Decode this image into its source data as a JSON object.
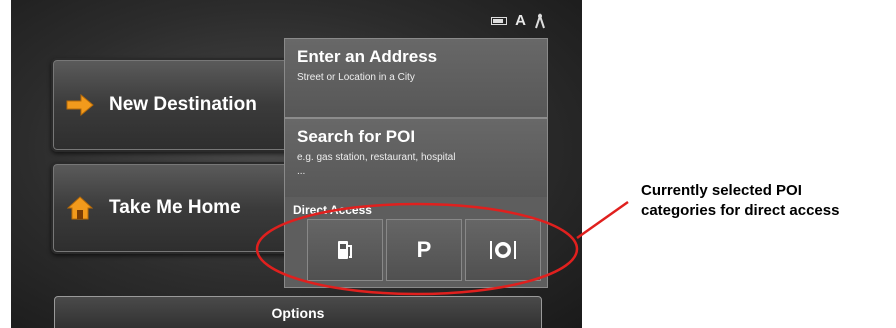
{
  "menu": {
    "new_destination": "New Destination",
    "take_me_home": "Take Me Home",
    "options": "Options"
  },
  "right_panel": {
    "enter_address": {
      "title": "Enter an Address",
      "subtitle": "Street or Location in a City"
    },
    "search_poi": {
      "title": "Search for POI",
      "subtitle_line1": "e.g. gas station, restaurant, hospital",
      "subtitle_line2": "..."
    },
    "direct_access_label": "Direct Access",
    "poi_buttons": [
      {
        "icon": "gas-pump-icon"
      },
      {
        "icon": "parking-icon",
        "label": "P"
      },
      {
        "icon": "restaurant-icon"
      }
    ]
  },
  "annotation": {
    "line1": "Currently selected POI",
    "line2": "categories for direct access",
    "color": "#e0201e"
  },
  "status_icons": [
    "battery-icon",
    "text-a-icon",
    "satellite-icon"
  ],
  "status_text": "A"
}
